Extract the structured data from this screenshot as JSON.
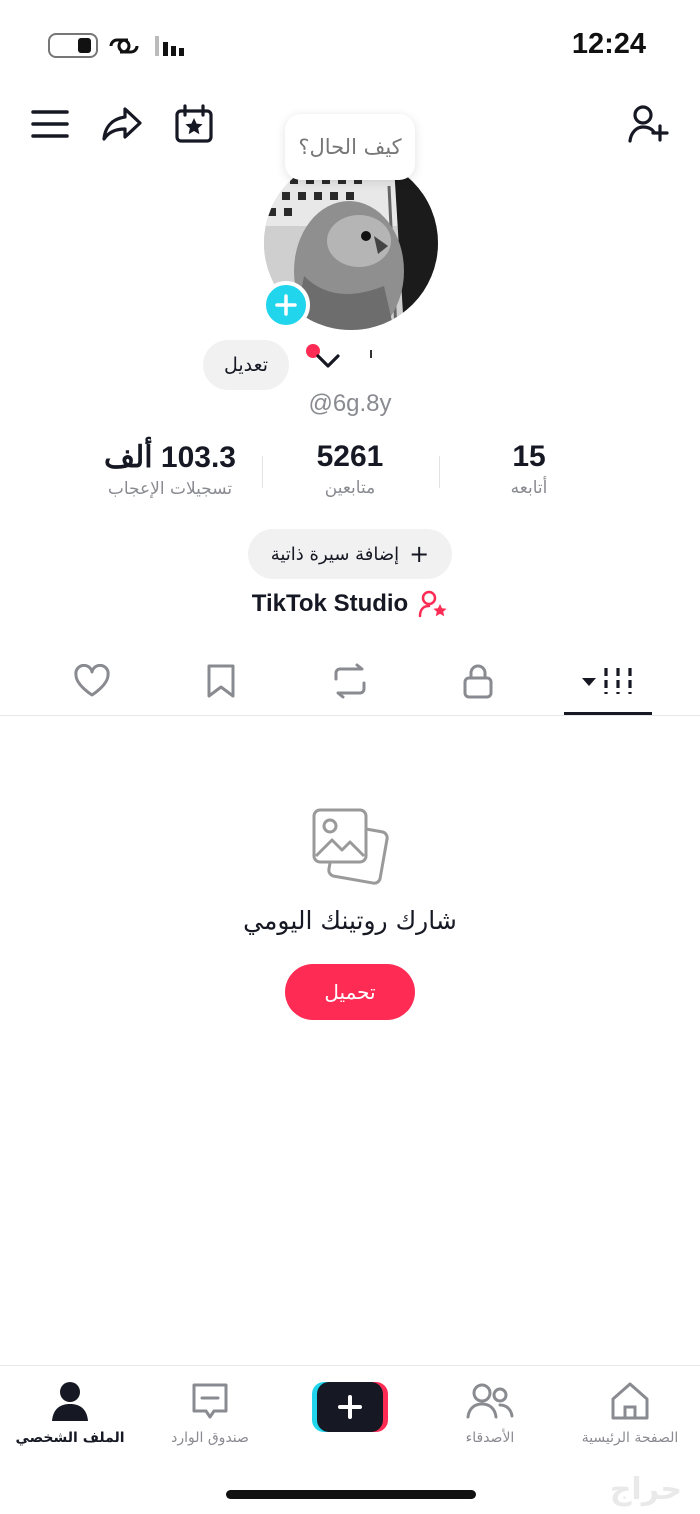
{
  "status_bar": {
    "time": "12:24"
  },
  "profile": {
    "bubble_text": "كيف الحال؟",
    "edit_label": "تعديل",
    "username": "@6g.8y"
  },
  "stats": [
    {
      "value": "103.3 ألف",
      "label": "تسجيلات الإعجاب"
    },
    {
      "value": "5261",
      "label": "متابعين"
    },
    {
      "value": "15",
      "label": "أتابعه"
    }
  ],
  "bio_button": "إضافة سيرة ذاتية",
  "studio_label": "TikTok Studio",
  "empty_state": {
    "title": "شارك روتينك اليومي",
    "button": "تحميل"
  },
  "bottom_nav": {
    "profile": "الملف الشخصي",
    "inbox": "صندوق الوارد",
    "friends": "الأصدقاء",
    "home": "الصفحة الرئيسية"
  },
  "watermark": "حراج",
  "colors": {
    "accent": "#fe2c55",
    "cyan": "#20d5ec",
    "text": "#161823",
    "muted": "#8a8b91"
  }
}
